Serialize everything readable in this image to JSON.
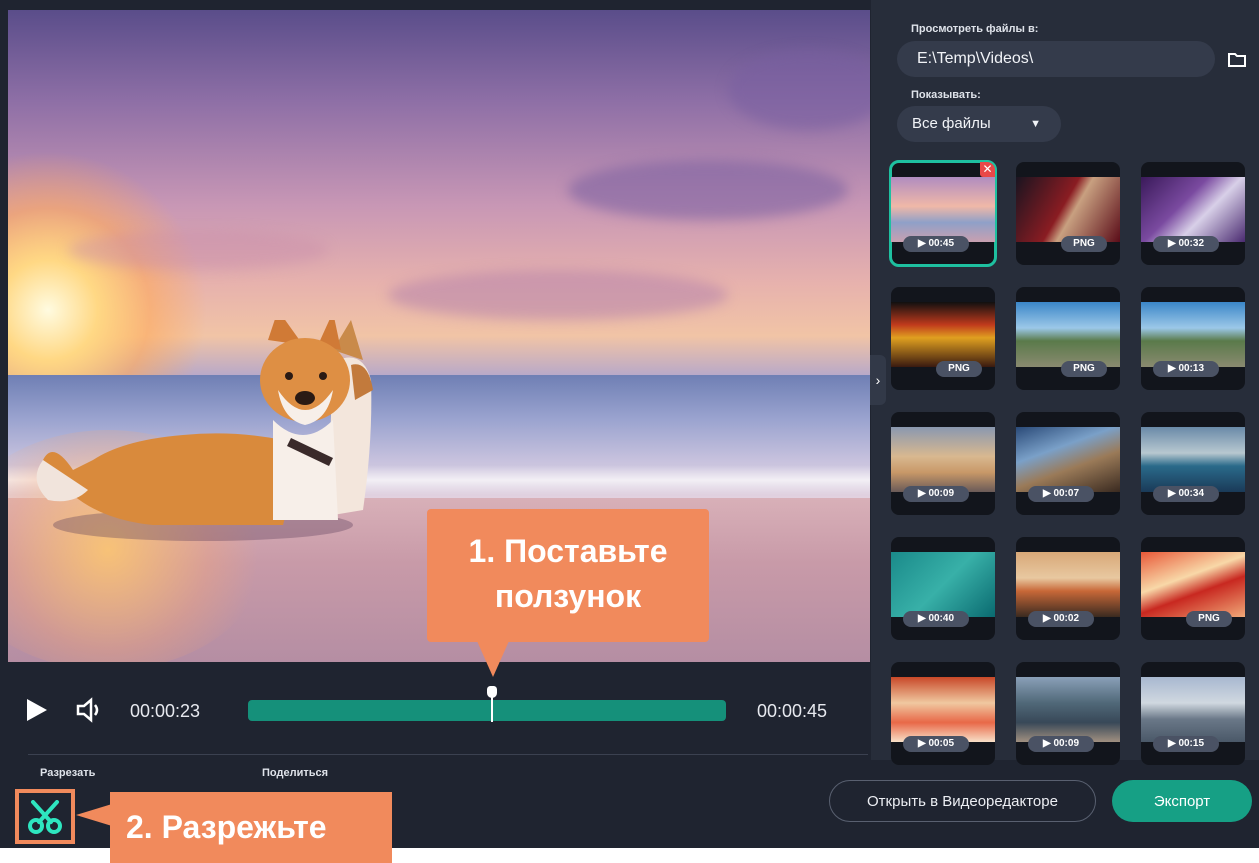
{
  "player": {
    "time_current": "00:00:23",
    "time_total": "00:00:45",
    "playhead_fraction": 0.51
  },
  "bottom": {
    "cut_label": "Разрезать",
    "share_label": "Поделиться",
    "open_editor_label": "Открыть в Видеоредакторе",
    "export_label": "Экспорт"
  },
  "panel": {
    "browse_label": "Просмотреть файлы в:",
    "path_value": "E:\\Temp\\Videos\\",
    "show_label": "Показывать:",
    "filter_value": "Все файлы",
    "thumbnails": [
      {
        "badge": "▶ 00:45",
        "selected": true
      },
      {
        "badge": "PNG"
      },
      {
        "badge": "▶ 00:32"
      },
      {
        "badge": "PNG"
      },
      {
        "badge": "PNG"
      },
      {
        "badge": "▶ 00:13"
      },
      {
        "badge": "▶ 00:09"
      },
      {
        "badge": "▶ 00:07"
      },
      {
        "badge": "▶ 00:34"
      },
      {
        "badge": "▶ 00:40"
      },
      {
        "badge": "▶ 00:02"
      },
      {
        "badge": "PNG"
      },
      {
        "badge": "▶ 00:05"
      },
      {
        "badge": "▶ 00:09"
      },
      {
        "badge": "▶ 00:15"
      }
    ]
  },
  "callouts": {
    "step1_line1": "1. Поставьте",
    "step1_line2": "ползунок",
    "step2": "2. Разрежьте"
  },
  "colors": {
    "accent": "#16a085",
    "timeline": "#15907a",
    "callout": "#f18a5c",
    "background": "#1f2430",
    "panel": "#272d3a"
  }
}
